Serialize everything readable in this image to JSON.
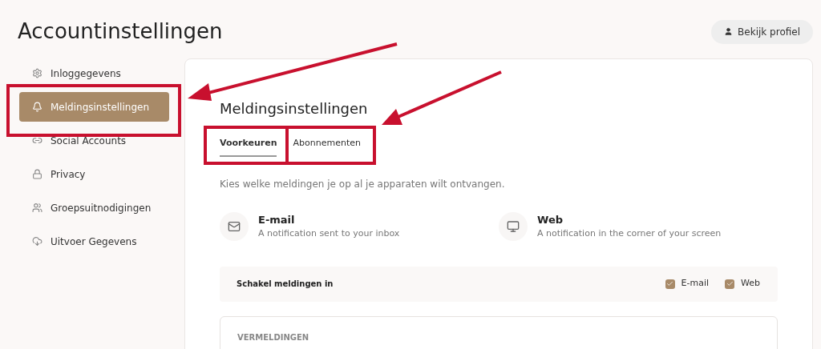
{
  "page": {
    "title": "Accountinstellingen",
    "profile_button": "Bekijk profiel"
  },
  "sidebar": {
    "items": [
      {
        "label": "Inloggegevens",
        "selected": false
      },
      {
        "label": "Meldingsinstellingen",
        "selected": true
      },
      {
        "label": "Social Accounts",
        "selected": false
      },
      {
        "label": "Privacy",
        "selected": false
      },
      {
        "label": "Groepsuitnodigingen",
        "selected": false
      },
      {
        "label": "Uitvoer Gegevens",
        "selected": false
      }
    ]
  },
  "panel": {
    "title": "Meldingsinstellingen",
    "tabs": [
      {
        "label": "Voorkeuren",
        "selected": true
      },
      {
        "label": "Abonnementen",
        "selected": false
      }
    ],
    "description": "Kies welke meldingen je op al je apparaten wilt ontvangen.",
    "channels": [
      {
        "name": "E-mail",
        "detail": "A notification sent to your inbox"
      },
      {
        "name": "Web",
        "detail": "A notification in the corner of your screen"
      }
    ],
    "toggle_row": {
      "label": "Schakel meldingen in",
      "options": [
        {
          "label": "E-mail",
          "checked": true
        },
        {
          "label": "Web",
          "checked": true
        }
      ]
    },
    "section_heading": "VERMELDINGEN"
  }
}
